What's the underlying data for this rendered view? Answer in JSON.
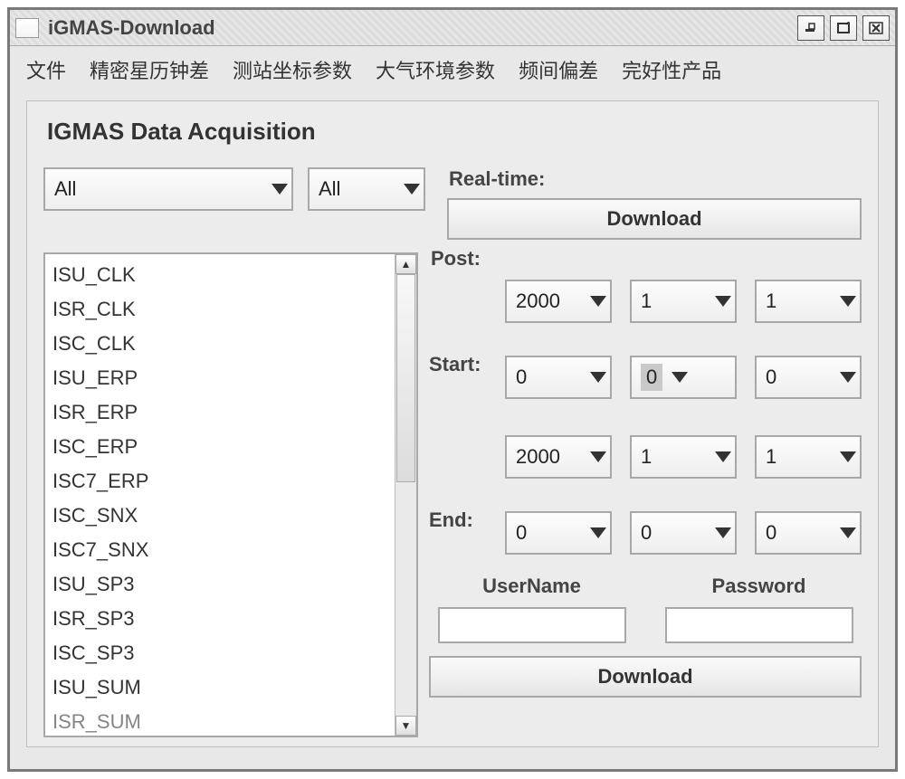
{
  "window": {
    "title": "iGMAS-Download"
  },
  "menu": {
    "items": [
      "文件",
      "精密星历钟差",
      "测站坐标参数",
      "大气环境参数",
      "频间偏差",
      "完好性产品"
    ]
  },
  "panel": {
    "heading": "IGMAS Data Acquisition",
    "filter1": "All",
    "filter2": "All",
    "realtime_label": "Real-time:",
    "download_btn": "Download",
    "post_label": "Post:",
    "start_label": "Start:",
    "end_label": "End:",
    "start_row1": {
      "a": "2000",
      "b": "1",
      "c": "1"
    },
    "start_row2": {
      "a": "0",
      "b": "0",
      "c": "0"
    },
    "end_row1": {
      "a": "2000",
      "b": "1",
      "c": "1"
    },
    "end_row2": {
      "a": "0",
      "b": "0",
      "c": "0"
    },
    "username_label": "UserName",
    "password_label": "Password",
    "download_btn2": "Download"
  },
  "list": {
    "items": [
      "ISU_CLK",
      "ISR_CLK",
      "ISC_CLK",
      "ISU_ERP",
      "ISR_ERP",
      "ISC_ERP",
      "ISC7_ERP",
      "ISC_SNX",
      "ISC7_SNX",
      "ISU_SP3",
      "ISR_SP3",
      "ISC_SP3",
      "ISU_SUM",
      "ISR_SUM"
    ]
  }
}
